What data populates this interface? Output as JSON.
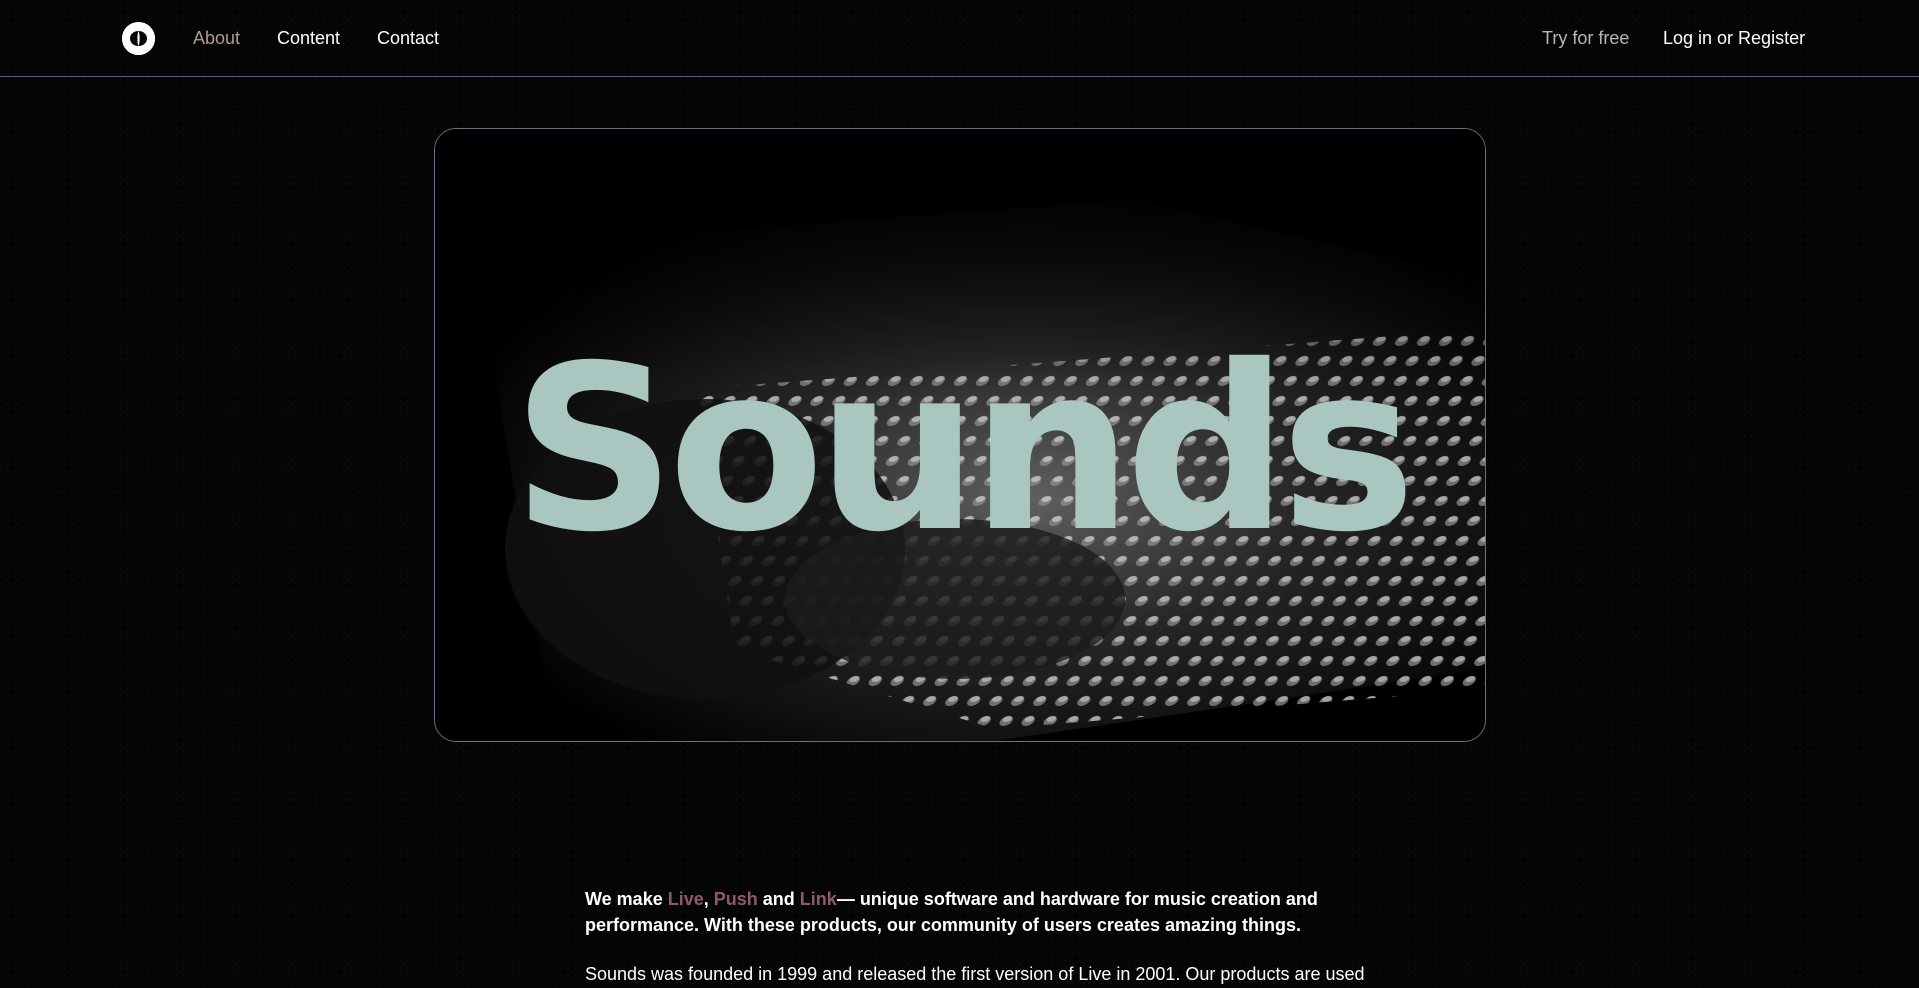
{
  "nav": {
    "logo_icon": "sounds-logo-icon",
    "links": {
      "about": "About",
      "content": "Content",
      "contact": "Contact"
    },
    "try_free": "Try for free",
    "login": "Log in or Register"
  },
  "hero": {
    "image": "mixing-console-photo",
    "wordmark": "Sounds",
    "wordmark_color": "#a9c7c0"
  },
  "intro": {
    "we_make": "We make ",
    "live": "Live",
    "comma": ", ",
    "push": "Push",
    "and": " and ",
    "link": "Link",
    "rest": "— unique software and hardware for music creation and performance. With these products, our community of users creates amazing things."
  },
  "body": {
    "text": "Sounds was founded in 1999 and released the first version of Live in 2001. Our products are used"
  },
  "colors": {
    "background": "#050505",
    "accent_nav_active": "#b39a8e",
    "product_highlight": "#8e5a6a",
    "border": "#6b7080"
  }
}
